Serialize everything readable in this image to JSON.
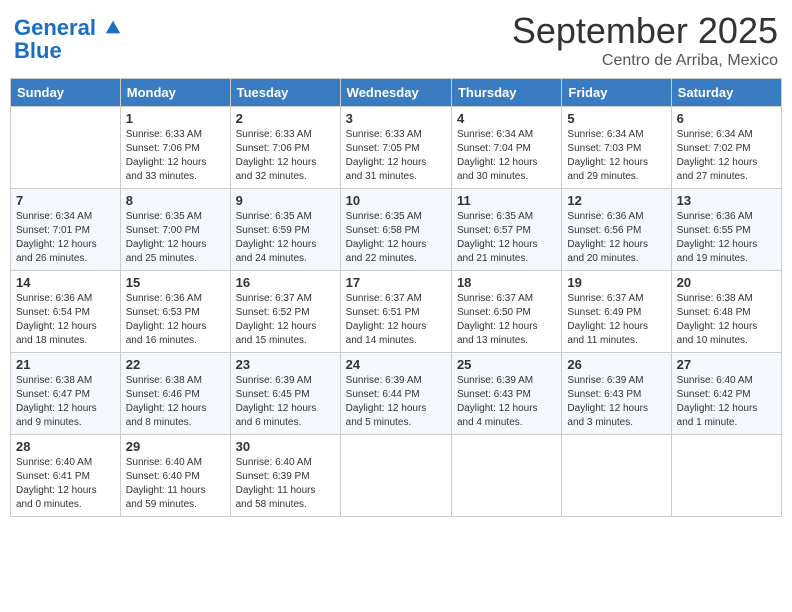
{
  "header": {
    "logo_line1": "General",
    "logo_line2": "Blue",
    "month": "September 2025",
    "location": "Centro de Arriba, Mexico"
  },
  "weekdays": [
    "Sunday",
    "Monday",
    "Tuesday",
    "Wednesday",
    "Thursday",
    "Friday",
    "Saturday"
  ],
  "weeks": [
    [
      {
        "day": "",
        "info": ""
      },
      {
        "day": "1",
        "info": "Sunrise: 6:33 AM\nSunset: 7:06 PM\nDaylight: 12 hours\nand 33 minutes."
      },
      {
        "day": "2",
        "info": "Sunrise: 6:33 AM\nSunset: 7:06 PM\nDaylight: 12 hours\nand 32 minutes."
      },
      {
        "day": "3",
        "info": "Sunrise: 6:33 AM\nSunset: 7:05 PM\nDaylight: 12 hours\nand 31 minutes."
      },
      {
        "day": "4",
        "info": "Sunrise: 6:34 AM\nSunset: 7:04 PM\nDaylight: 12 hours\nand 30 minutes."
      },
      {
        "day": "5",
        "info": "Sunrise: 6:34 AM\nSunset: 7:03 PM\nDaylight: 12 hours\nand 29 minutes."
      },
      {
        "day": "6",
        "info": "Sunrise: 6:34 AM\nSunset: 7:02 PM\nDaylight: 12 hours\nand 27 minutes."
      }
    ],
    [
      {
        "day": "7",
        "info": "Sunrise: 6:34 AM\nSunset: 7:01 PM\nDaylight: 12 hours\nand 26 minutes."
      },
      {
        "day": "8",
        "info": "Sunrise: 6:35 AM\nSunset: 7:00 PM\nDaylight: 12 hours\nand 25 minutes."
      },
      {
        "day": "9",
        "info": "Sunrise: 6:35 AM\nSunset: 6:59 PM\nDaylight: 12 hours\nand 24 minutes."
      },
      {
        "day": "10",
        "info": "Sunrise: 6:35 AM\nSunset: 6:58 PM\nDaylight: 12 hours\nand 22 minutes."
      },
      {
        "day": "11",
        "info": "Sunrise: 6:35 AM\nSunset: 6:57 PM\nDaylight: 12 hours\nand 21 minutes."
      },
      {
        "day": "12",
        "info": "Sunrise: 6:36 AM\nSunset: 6:56 PM\nDaylight: 12 hours\nand 20 minutes."
      },
      {
        "day": "13",
        "info": "Sunrise: 6:36 AM\nSunset: 6:55 PM\nDaylight: 12 hours\nand 19 minutes."
      }
    ],
    [
      {
        "day": "14",
        "info": "Sunrise: 6:36 AM\nSunset: 6:54 PM\nDaylight: 12 hours\nand 18 minutes."
      },
      {
        "day": "15",
        "info": "Sunrise: 6:36 AM\nSunset: 6:53 PM\nDaylight: 12 hours\nand 16 minutes."
      },
      {
        "day": "16",
        "info": "Sunrise: 6:37 AM\nSunset: 6:52 PM\nDaylight: 12 hours\nand 15 minutes."
      },
      {
        "day": "17",
        "info": "Sunrise: 6:37 AM\nSunset: 6:51 PM\nDaylight: 12 hours\nand 14 minutes."
      },
      {
        "day": "18",
        "info": "Sunrise: 6:37 AM\nSunset: 6:50 PM\nDaylight: 12 hours\nand 13 minutes."
      },
      {
        "day": "19",
        "info": "Sunrise: 6:37 AM\nSunset: 6:49 PM\nDaylight: 12 hours\nand 11 minutes."
      },
      {
        "day": "20",
        "info": "Sunrise: 6:38 AM\nSunset: 6:48 PM\nDaylight: 12 hours\nand 10 minutes."
      }
    ],
    [
      {
        "day": "21",
        "info": "Sunrise: 6:38 AM\nSunset: 6:47 PM\nDaylight: 12 hours\nand 9 minutes."
      },
      {
        "day": "22",
        "info": "Sunrise: 6:38 AM\nSunset: 6:46 PM\nDaylight: 12 hours\nand 8 minutes."
      },
      {
        "day": "23",
        "info": "Sunrise: 6:39 AM\nSunset: 6:45 PM\nDaylight: 12 hours\nand 6 minutes."
      },
      {
        "day": "24",
        "info": "Sunrise: 6:39 AM\nSunset: 6:44 PM\nDaylight: 12 hours\nand 5 minutes."
      },
      {
        "day": "25",
        "info": "Sunrise: 6:39 AM\nSunset: 6:43 PM\nDaylight: 12 hours\nand 4 minutes."
      },
      {
        "day": "26",
        "info": "Sunrise: 6:39 AM\nSunset: 6:43 PM\nDaylight: 12 hours\nand 3 minutes."
      },
      {
        "day": "27",
        "info": "Sunrise: 6:40 AM\nSunset: 6:42 PM\nDaylight: 12 hours\nand 1 minute."
      }
    ],
    [
      {
        "day": "28",
        "info": "Sunrise: 6:40 AM\nSunset: 6:41 PM\nDaylight: 12 hours\nand 0 minutes."
      },
      {
        "day": "29",
        "info": "Sunrise: 6:40 AM\nSunset: 6:40 PM\nDaylight: 11 hours\nand 59 minutes."
      },
      {
        "day": "30",
        "info": "Sunrise: 6:40 AM\nSunset: 6:39 PM\nDaylight: 11 hours\nand 58 minutes."
      },
      {
        "day": "",
        "info": ""
      },
      {
        "day": "",
        "info": ""
      },
      {
        "day": "",
        "info": ""
      },
      {
        "day": "",
        "info": ""
      }
    ]
  ]
}
